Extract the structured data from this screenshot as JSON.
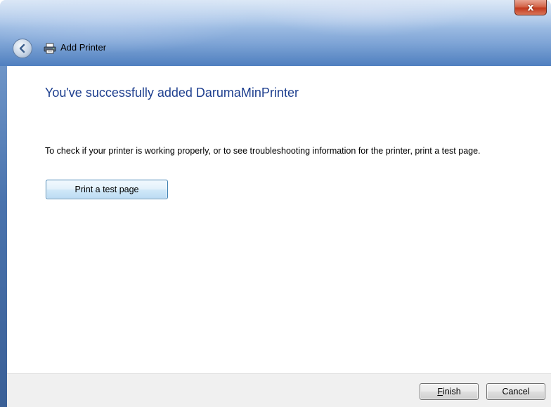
{
  "window": {
    "title": "Add Printer",
    "close_symbol": "x",
    "back_icon": "back-arrow-icon",
    "title_icon": "printer-icon"
  },
  "main": {
    "heading": "You've successfully added DarumaMinPrinter",
    "description": "To check if your printer is working properly, or to see troubleshooting information for the printer, print a test page.",
    "print_test_label": "Print a test page"
  },
  "footer": {
    "finish_accel": "F",
    "finish_rest": "inish",
    "cancel_label": "Cancel"
  },
  "colors": {
    "heading": "#1e3f8f",
    "titlebar": "#7fa5d6",
    "close": "#c23a1e",
    "footer_bg": "#f0f0f0"
  }
}
